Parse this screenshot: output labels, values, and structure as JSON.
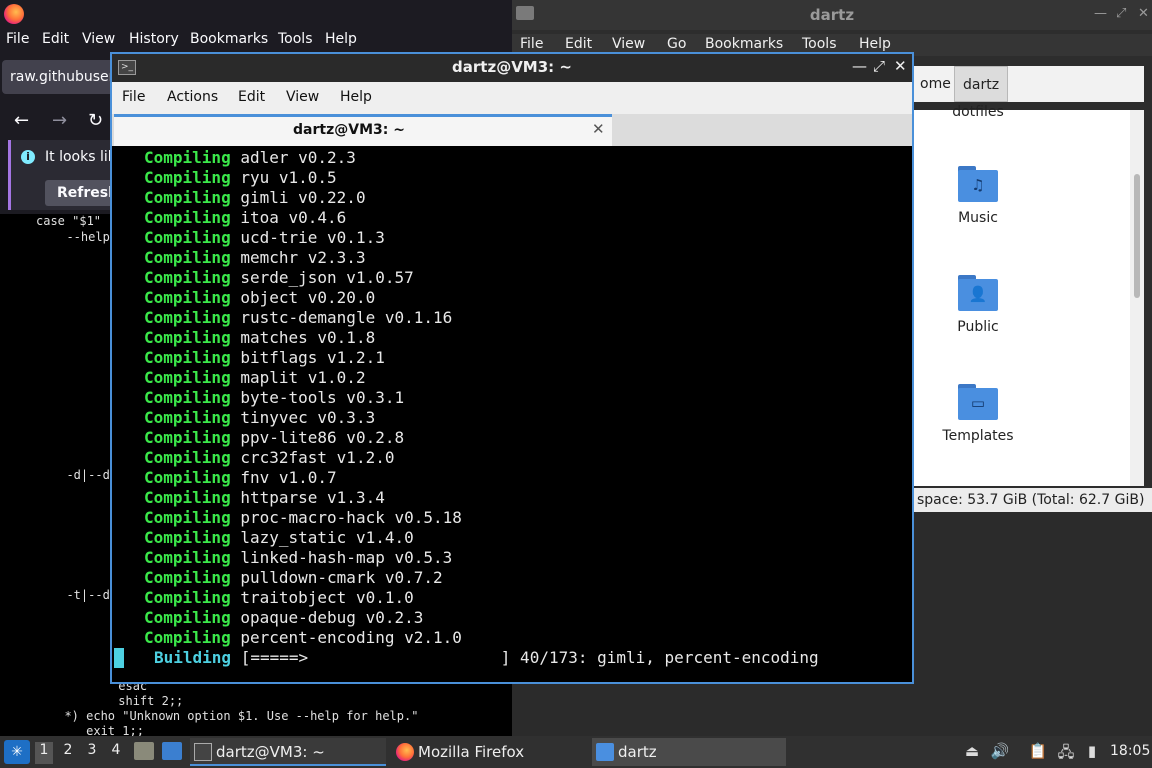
{
  "firefox": {
    "menu": [
      "File",
      "Edit",
      "View",
      "History",
      "Bookmarks",
      "Tools",
      "Help"
    ],
    "tab_label": "raw.githubuser",
    "notice_text": "It looks lik",
    "refresh_label": "Refresh",
    "code_lines": [
      "case \"$1\"",
      "  --help",
      "  -d|--d",
      "  -t|--d",
      "          esac",
      "          shift 2;;",
      "  *) echo \"Unknown option $1. Use --help for help.\"",
      "     exit 1;;"
    ]
  },
  "file_manager": {
    "title": "dartz",
    "menu": [
      "File",
      "Edit",
      "View",
      "Go",
      "Bookmarks",
      "Tools",
      "Help"
    ],
    "breadcrumbs": [
      "ome",
      "dartz"
    ],
    "items": [
      {
        "name": "dotfiles",
        "glyph": ""
      },
      {
        "name": "Music",
        "glyph": "♫"
      },
      {
        "name": "Public",
        "glyph": "👤"
      },
      {
        "name": "Templates",
        "glyph": "▭"
      }
    ],
    "status": "space: 53.7 GiB (Total: 62.7 GiB)"
  },
  "terminal": {
    "title": "dartz@VM3: ~",
    "menu": [
      "File",
      "Actions",
      "Edit",
      "View",
      "Help"
    ],
    "tab_label": "dartz@VM3: ~",
    "compiling_keyword": "Compiling",
    "packages": [
      "adler v0.2.3",
      "ryu v1.0.5",
      "gimli v0.22.0",
      "itoa v0.4.6",
      "ucd-trie v0.1.3",
      "memchr v2.3.3",
      "serde_json v1.0.57",
      "object v0.20.0",
      "rustc-demangle v0.1.16",
      "matches v0.1.8",
      "bitflags v1.2.1",
      "maplit v1.0.2",
      "byte-tools v0.3.1",
      "tinyvec v0.3.3",
      "ppv-lite86 v0.2.8",
      "crc32fast v1.2.0",
      "fnv v1.0.7",
      "httparse v1.3.4",
      "proc-macro-hack v0.5.18",
      "lazy_static v1.4.0",
      "linked-hash-map v0.5.3",
      "pulldown-cmark v0.7.2",
      "traitobject v0.1.0",
      "opaque-debug v0.2.3",
      "percent-encoding v2.1.0"
    ],
    "building_keyword": "Building",
    "building_progress": "[=====>                    ] 40/173: gimli, percent-encoding"
  },
  "taskbar": {
    "workspaces": [
      "1",
      "2",
      "3",
      "4"
    ],
    "tasks": [
      {
        "label": "dartz@VM3: ~"
      },
      {
        "label": "Mozilla Firefox"
      },
      {
        "label": "dartz"
      }
    ],
    "clock": "18:05"
  },
  "colors": {
    "terminal_green": "#3be84a",
    "accent_blue": "#4a90d9",
    "cursor_cyan": "#4dd0e1"
  }
}
